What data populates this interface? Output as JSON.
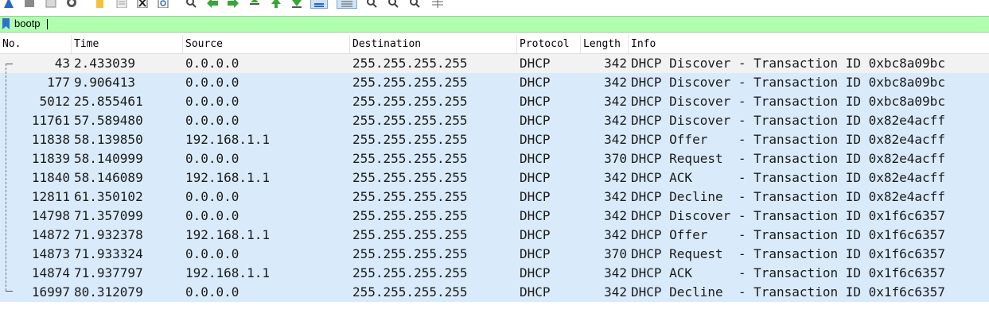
{
  "filter": {
    "value": "bootp"
  },
  "columns": [
    "No.",
    "Time",
    "Source",
    "Destination",
    "Protocol",
    "Length",
    "Info"
  ],
  "packets": [
    {
      "no": "43",
      "time": "2.433039",
      "source": "0.0.0.0",
      "destination": "255.255.255.255",
      "protocol": "DHCP",
      "length": "342",
      "info": "DHCP Discover - Transaction ID 0xbc8a09bc"
    },
    {
      "no": "177",
      "time": "9.906413",
      "source": "0.0.0.0",
      "destination": "255.255.255.255",
      "protocol": "DHCP",
      "length": "342",
      "info": "DHCP Discover - Transaction ID 0xbc8a09bc"
    },
    {
      "no": "5012",
      "time": "25.855461",
      "source": "0.0.0.0",
      "destination": "255.255.255.255",
      "protocol": "DHCP",
      "length": "342",
      "info": "DHCP Discover - Transaction ID 0xbc8a09bc"
    },
    {
      "no": "11761",
      "time": "57.589480",
      "source": "0.0.0.0",
      "destination": "255.255.255.255",
      "protocol": "DHCP",
      "length": "342",
      "info": "DHCP Discover - Transaction ID 0x82e4acff"
    },
    {
      "no": "11838",
      "time": "58.139850",
      "source": "192.168.1.1",
      "destination": "255.255.255.255",
      "protocol": "DHCP",
      "length": "342",
      "info": "DHCP Offer    - Transaction ID 0x82e4acff"
    },
    {
      "no": "11839",
      "time": "58.140999",
      "source": "0.0.0.0",
      "destination": "255.255.255.255",
      "protocol": "DHCP",
      "length": "370",
      "info": "DHCP Request  - Transaction ID 0x82e4acff"
    },
    {
      "no": "11840",
      "time": "58.146089",
      "source": "192.168.1.1",
      "destination": "255.255.255.255",
      "protocol": "DHCP",
      "length": "342",
      "info": "DHCP ACK      - Transaction ID 0x82e4acff"
    },
    {
      "no": "12811",
      "time": "61.350102",
      "source": "0.0.0.0",
      "destination": "255.255.255.255",
      "protocol": "DHCP",
      "length": "342",
      "info": "DHCP Decline  - Transaction ID 0x82e4acff"
    },
    {
      "no": "14798",
      "time": "71.357099",
      "source": "0.0.0.0",
      "destination": "255.255.255.255",
      "protocol": "DHCP",
      "length": "342",
      "info": "DHCP Discover - Transaction ID 0x1f6c6357"
    },
    {
      "no": "14872",
      "time": "71.932378",
      "source": "192.168.1.1",
      "destination": "255.255.255.255",
      "protocol": "DHCP",
      "length": "342",
      "info": "DHCP Offer    - Transaction ID 0x1f6c6357"
    },
    {
      "no": "14873",
      "time": "71.933324",
      "source": "0.0.0.0",
      "destination": "255.255.255.255",
      "protocol": "DHCP",
      "length": "370",
      "info": "DHCP Request  - Transaction ID 0x1f6c6357"
    },
    {
      "no": "14874",
      "time": "71.937797",
      "source": "192.168.1.1",
      "destination": "255.255.255.255",
      "protocol": "DHCP",
      "length": "342",
      "info": "DHCP ACK      - Transaction ID 0x1f6c6357"
    },
    {
      "no": "16997",
      "time": "80.312079",
      "source": "0.0.0.0",
      "destination": "255.255.255.255",
      "protocol": "DHCP",
      "length": "342",
      "info": "DHCP Decline  - Transaction ID 0x1f6c6357"
    }
  ],
  "toolbar": {
    "icons": [
      "start-capture-icon",
      "stop-capture-icon",
      "restart-capture-icon",
      "capture-options-icon",
      "open-file-icon",
      "save-file-icon",
      "close-file-icon",
      "reload-file-icon",
      "find-packet-icon",
      "go-back-icon",
      "go-forward-icon",
      "go-to-packet-icon",
      "first-packet-icon",
      "last-packet-icon",
      "auto-scroll-icon",
      "colorize-icon",
      "zoom-in-icon",
      "zoom-out-icon",
      "normal-size-icon",
      "resize-columns-icon"
    ]
  },
  "colors": {
    "filter_bg": "#afffaf",
    "row_bg": "#d9ebfb",
    "selected_row_bg": "#f2f2f2"
  }
}
